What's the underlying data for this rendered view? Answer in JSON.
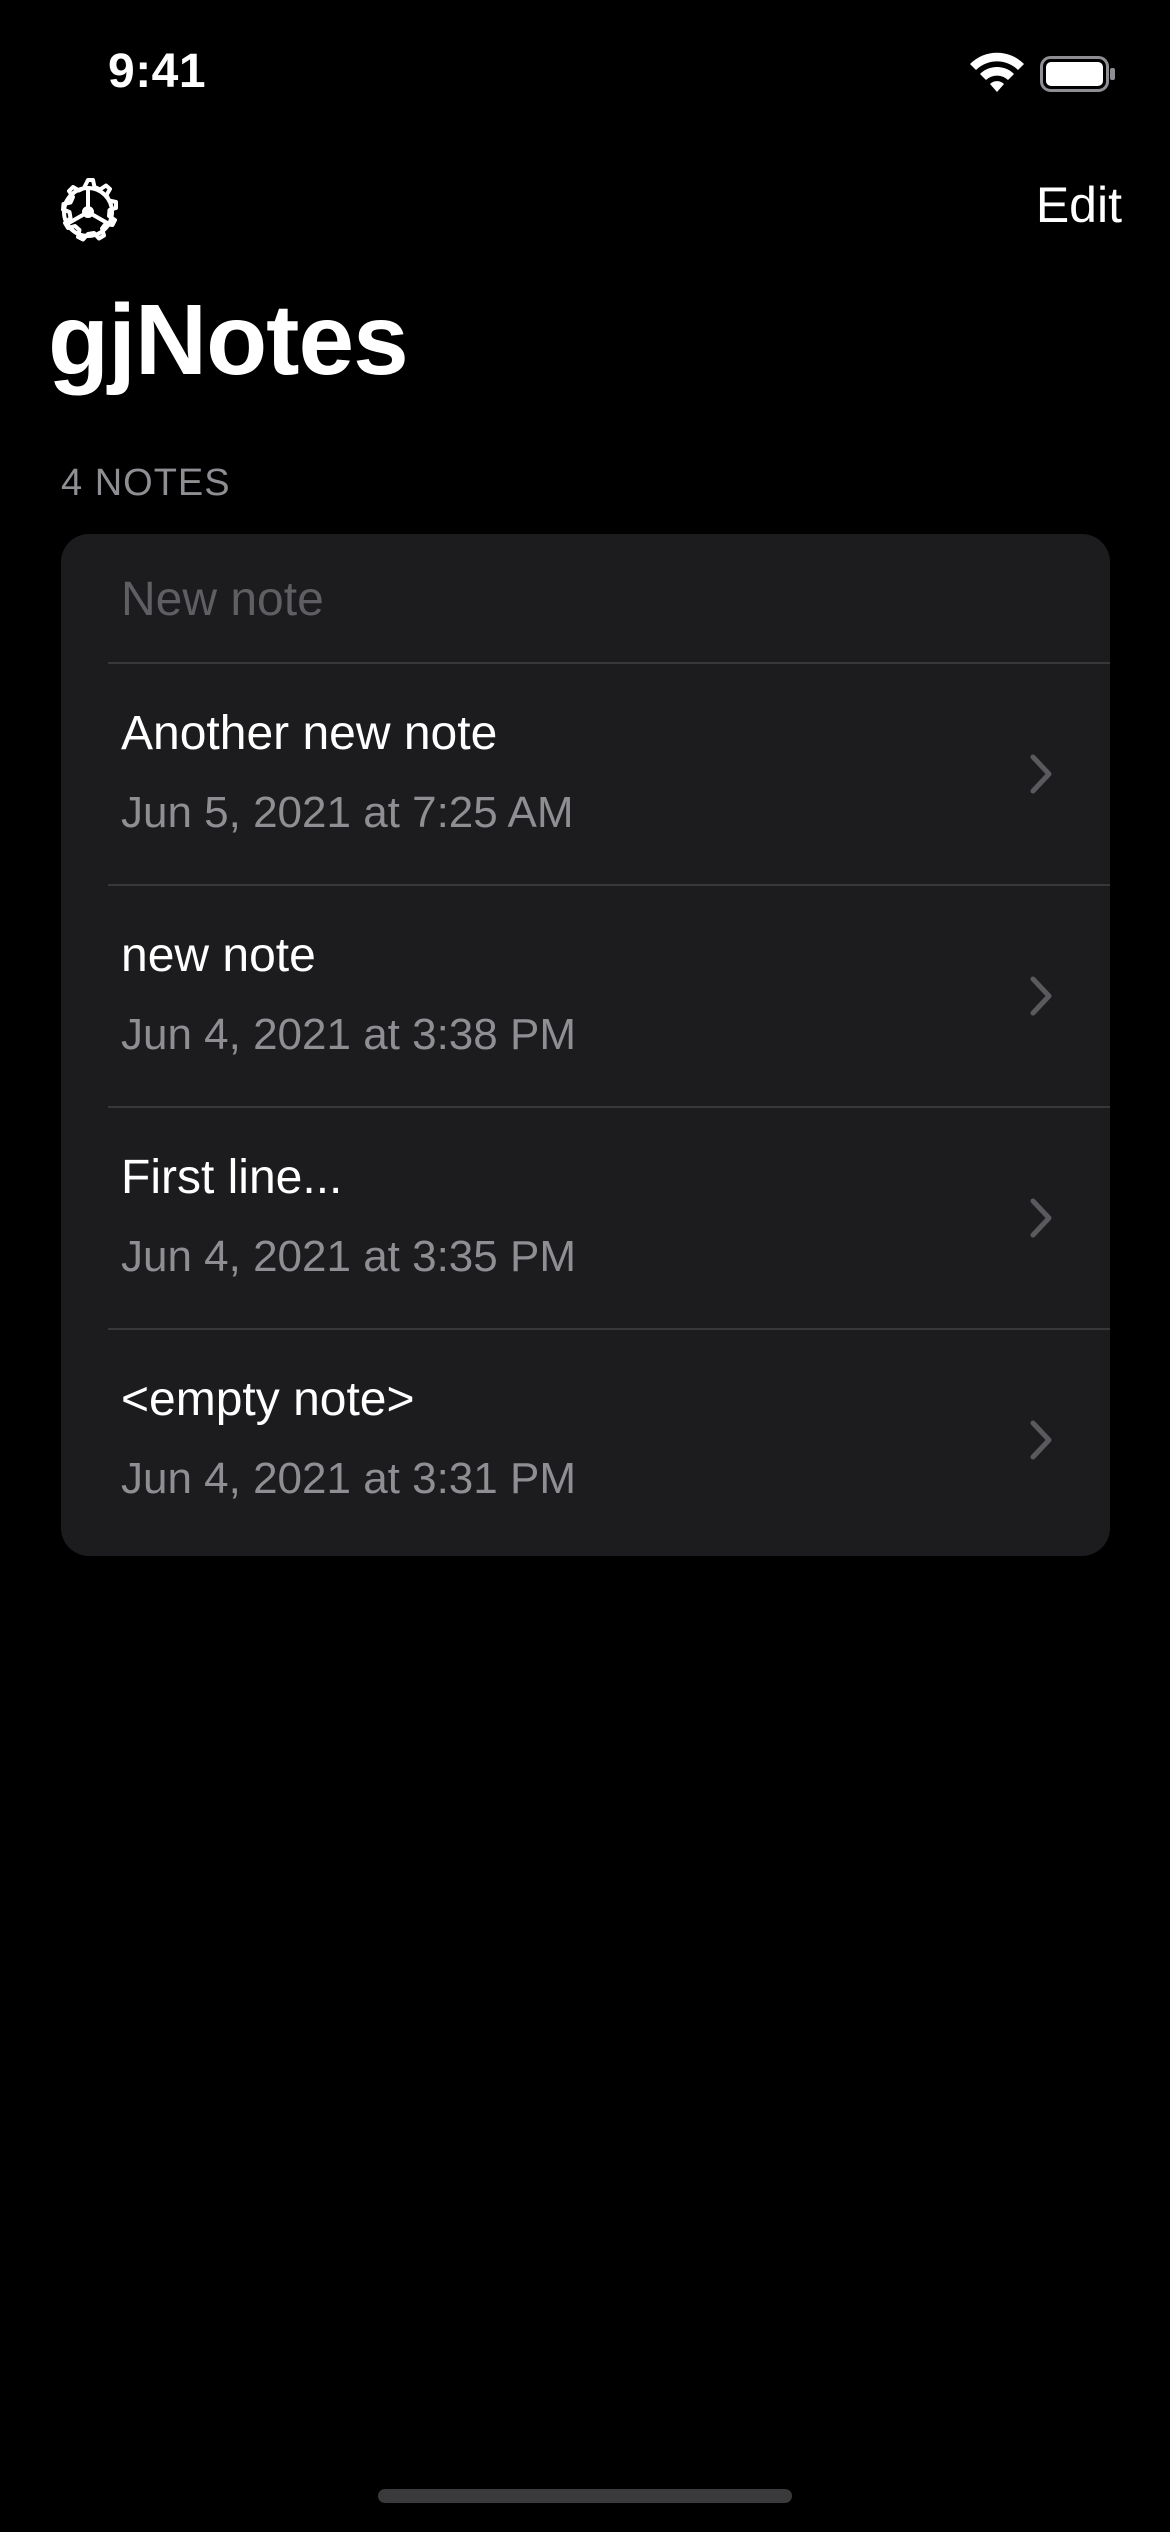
{
  "status_bar": {
    "time": "9:41",
    "icons": [
      "wifi-icon",
      "battery-icon"
    ]
  },
  "nav": {
    "settings_icon": "gear-icon",
    "edit_label": "Edit",
    "title": "gjNotes"
  },
  "list": {
    "section_header": "4 NOTES",
    "new_note_placeholder": "New note",
    "notes": [
      {
        "title": "Another new note",
        "date": "Jun 5, 2021 at 7:25 AM"
      },
      {
        "title": "new note",
        "date": "Jun 4, 2021 at 3:38 PM"
      },
      {
        "title": "First line...",
        "date": "Jun 4, 2021 at 3:35 PM"
      },
      {
        "title": "<empty note>",
        "date": "Jun 4, 2021 at 3:31 PM"
      }
    ]
  },
  "colors": {
    "background": "#000000",
    "card": "#1c1c1e",
    "separator": "#38383a",
    "secondary_text": "#8e8e93",
    "placeholder": "#5e5e63",
    "chevron": "#5a5a5e"
  }
}
